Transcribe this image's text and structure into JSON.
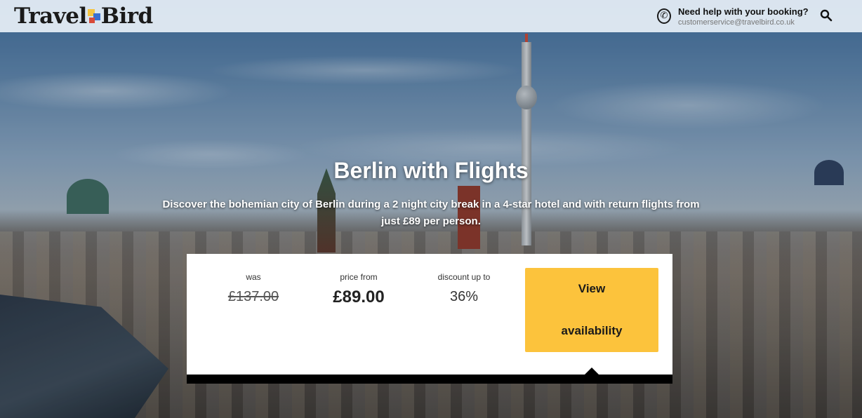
{
  "brand": {
    "logo_text_left": "Travel",
    "logo_text_right": "Bird"
  },
  "help": {
    "title": "Need help with your booking?",
    "email": "customerservice@travelbird.co.uk"
  },
  "icons": {
    "phone": "phone-icon",
    "search": "search-icon"
  },
  "hero": {
    "title": "Berlin with Flights",
    "description": "Discover the bohemian city of Berlin during a 2 night city break in a 4-star hotel and with return flights from just £89 per person."
  },
  "pricing": {
    "was_label": "was",
    "was_value": "£137.00",
    "price_label": "price from",
    "price_value": "£89.00",
    "discount_label": "discount up to",
    "discount_value": "36%",
    "cta_line1": "View",
    "cta_line2": "availability"
  },
  "colors": {
    "cta": "#fcc33c",
    "header_bg": "#e8f0f7"
  }
}
